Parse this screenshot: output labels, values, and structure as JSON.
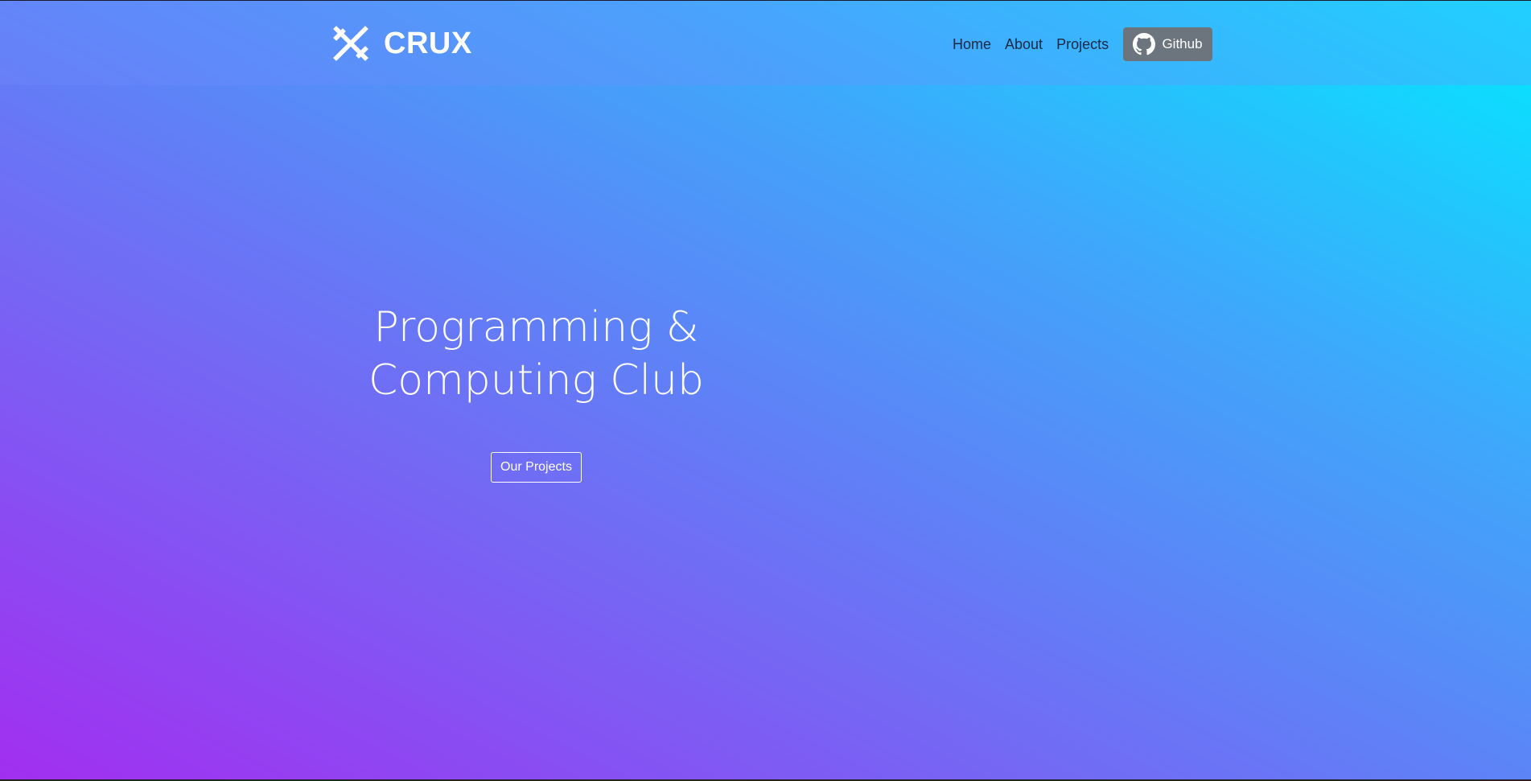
{
  "brand": {
    "name": "CRUX",
    "logo_icon": "crux-logo-icon"
  },
  "nav": {
    "items": [
      {
        "label": "Home"
      },
      {
        "label": "About"
      },
      {
        "label": "Projects"
      }
    ],
    "github_label": "Github",
    "github_icon": "github-icon"
  },
  "hero": {
    "title_line1": "Programming &",
    "title_line2": "Computing Club",
    "button_label": "Our Projects"
  },
  "colors": {
    "gradient_bottom_left": "#a22ef0",
    "gradient_top_right": "#00eaff",
    "nav_text": "#1c2846",
    "github_button": "#6c757d",
    "text": "#ffffff"
  }
}
